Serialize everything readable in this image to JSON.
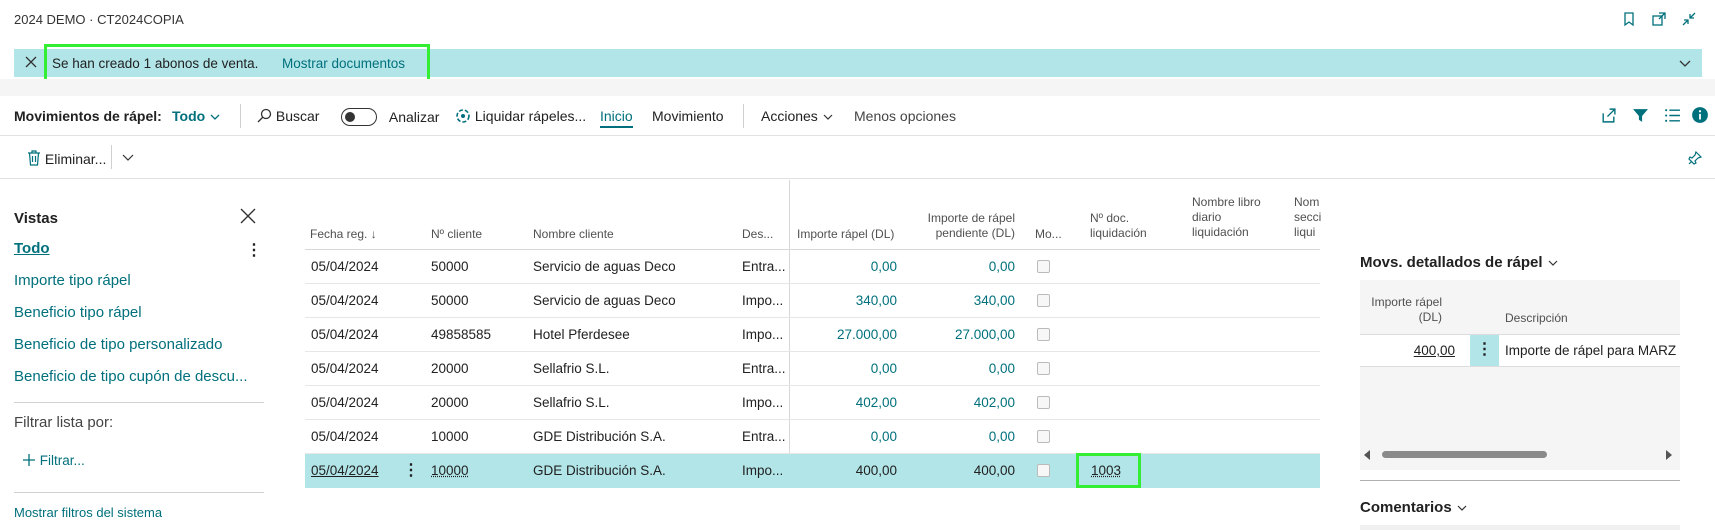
{
  "header": {
    "title": "2024 DEMO · CT2024COPIA"
  },
  "banner": {
    "message": "Se han creado 1 abonos de venta.",
    "link": "Mostrar documentos"
  },
  "actionbar": {
    "page_label": "Movimientos de rápel:",
    "filter_value": "Todo",
    "search": "Buscar",
    "analyze": "Analizar",
    "liquidate": "Liquidar rápeles...",
    "tab_home": "Inicio",
    "tab_movement": "Movimiento",
    "actions": "Acciones",
    "fewer_options": "Menos opciones"
  },
  "toolbar": {
    "delete": "Eliminar..."
  },
  "views": {
    "title": "Vistas",
    "items": [
      "Todo",
      "Importe tipo rápel",
      "Beneficio tipo rápel",
      "Beneficio de tipo personalizado",
      "Beneficio de tipo cupón de descu..."
    ],
    "filter_by": "Filtrar lista por:",
    "filter_button": "Filtrar...",
    "show_system_filters": "Mostrar filtros del sistema"
  },
  "table": {
    "headers": {
      "date": "Fecha reg. ↓",
      "customer_no": "Nº cliente",
      "customer_name": "Nombre cliente",
      "description": "Des...",
      "amount": "Importe rápel (DL)",
      "pending_1": "Importe de rápel",
      "pending_2": "pendiente (DL)",
      "mo": "Mo...",
      "doc_1": "Nº doc.",
      "doc_2": "liquidación",
      "journal_1": "Nombre libro",
      "journal_2": "diario",
      "journal_3": "liquidación",
      "section_1": "Nom",
      "section_2": "secci",
      "section_3": "liqui"
    },
    "rows": [
      {
        "date": "05/04/2024",
        "no": "50000",
        "name": "Servicio de aguas Deco",
        "desc": "Entra...",
        "amount": "0,00",
        "pending": "0,00",
        "doc": ""
      },
      {
        "date": "05/04/2024",
        "no": "50000",
        "name": "Servicio de aguas Deco",
        "desc": "Impo...",
        "amount": "340,00",
        "pending": "340,00",
        "doc": ""
      },
      {
        "date": "05/04/2024",
        "no": "49858585",
        "name": "Hotel Pferdesee",
        "desc": "Impo...",
        "amount": "27.000,00",
        "pending": "27.000,00",
        "doc": ""
      },
      {
        "date": "05/04/2024",
        "no": "20000",
        "name": "Sellafrio S.L.",
        "desc": "Entra...",
        "amount": "0,00",
        "pending": "0,00",
        "doc": ""
      },
      {
        "date": "05/04/2024",
        "no": "20000",
        "name": "Sellafrio S.L.",
        "desc": "Impo...",
        "amount": "402,00",
        "pending": "402,00",
        "doc": ""
      },
      {
        "date": "05/04/2024",
        "no": "10000",
        "name": "GDE Distribución S.A.",
        "desc": "Entra...",
        "amount": "0,00",
        "pending": "0,00",
        "doc": ""
      },
      {
        "date": "05/04/2024",
        "no": "10000",
        "name": "GDE Distribución S.A.",
        "desc": "Impo...",
        "amount": "400,00",
        "pending": "400,00",
        "doc": "1003"
      }
    ]
  },
  "factbox": {
    "title": "Movs. detallados de rápel",
    "col_amount_1": "Importe rápel",
    "col_amount_2": "(DL)",
    "col_desc": "Descripción",
    "row_amount": "400,00",
    "row_desc": "Importe de rápel para MARZ",
    "comments": "Comentarios"
  },
  "colors": {
    "accent": "#00707c",
    "banner_bg": "#b2e5e8",
    "highlight": "#33ee33",
    "selected_row": "#b2e5e8"
  }
}
